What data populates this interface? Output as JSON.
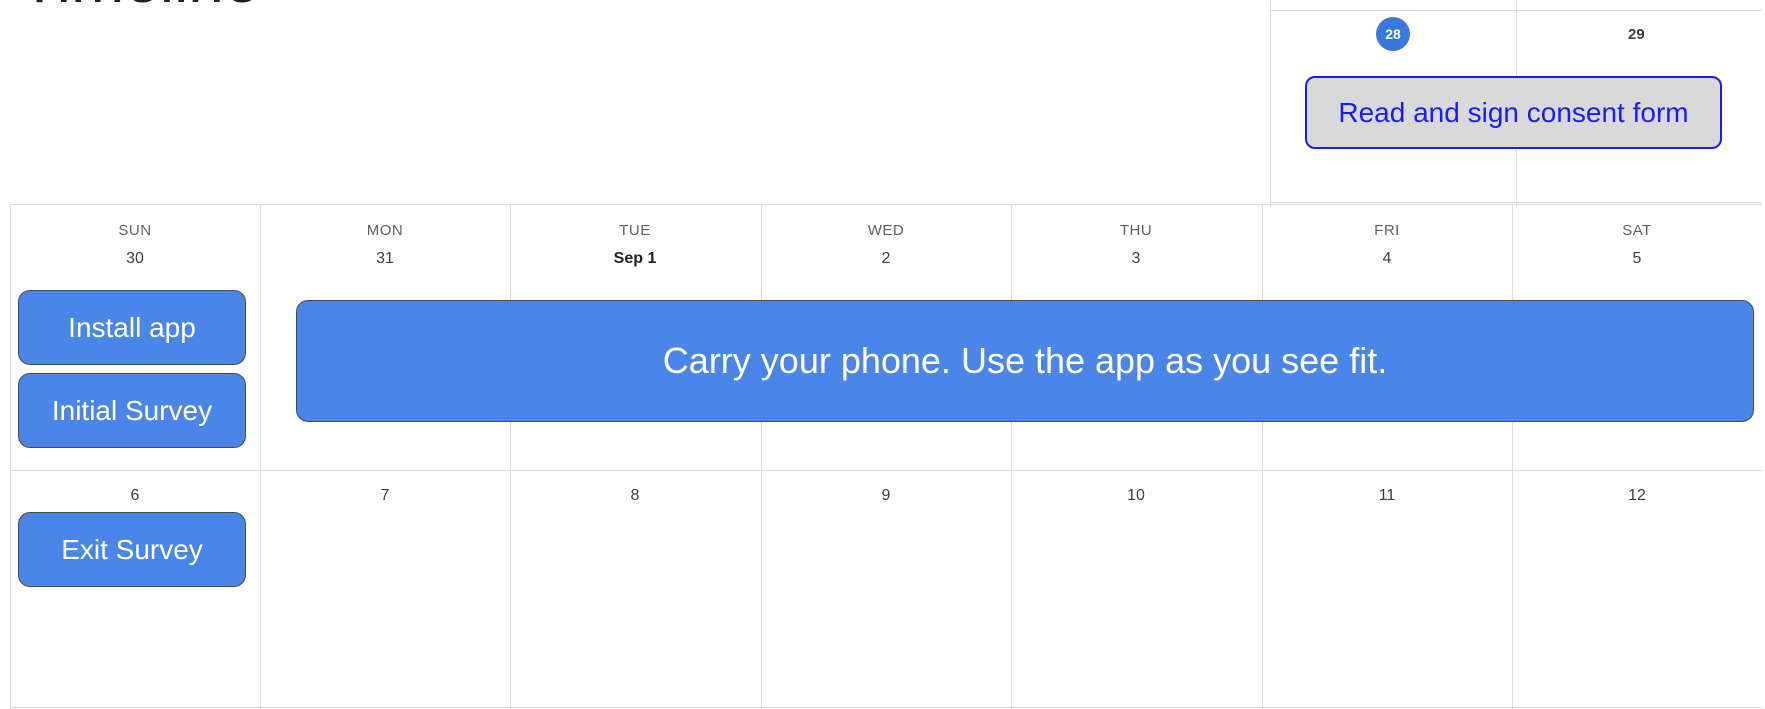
{
  "page": {
    "title": "Timeline"
  },
  "mini_calendar": {
    "highlighted_day": "28",
    "next_day": "29",
    "event": "Read and sign consent form"
  },
  "calendar": {
    "weekday_headers": [
      "SUN",
      "MON",
      "TUE",
      "WED",
      "THU",
      "FRI",
      "SAT"
    ],
    "week1_dates": [
      "30",
      "31",
      "Sep 1",
      "2",
      "3",
      "4",
      "5"
    ],
    "week2_dates": [
      "6",
      "7",
      "8",
      "9",
      "10",
      "11",
      "12"
    ],
    "events": {
      "install_app": "Install app",
      "initial_survey": "Initial Survey",
      "carry_phone": "Carry your phone. Use the app as you see fit.",
      "exit_survey": "Exit Survey"
    }
  },
  "colors": {
    "event_fill": "#4a86e8",
    "today_badge": "#3b78dc",
    "consent_fill": "#d9d9d9",
    "consent_text": "#1a1aff",
    "gridline": "#dadce0"
  }
}
